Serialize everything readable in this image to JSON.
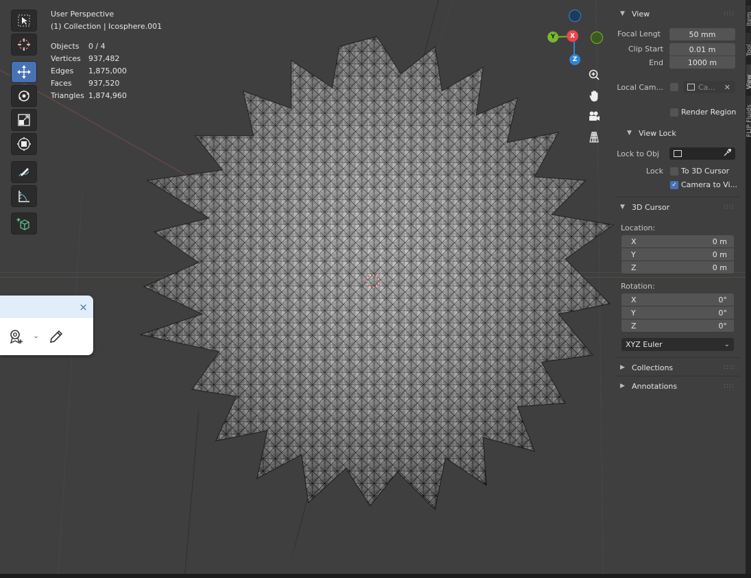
{
  "viewport": {
    "perspective": "User Perspective",
    "collection": "(1) Collection | Icosphere.001",
    "stats": [
      {
        "label": "Objects",
        "value": "0 / 4"
      },
      {
        "label": "Vertices",
        "value": "937,482"
      },
      {
        "label": "Edges",
        "value": "1,875,000"
      },
      {
        "label": "Faces",
        "value": "937,520"
      },
      {
        "label": "Triangles",
        "value": "1,874,960"
      }
    ]
  },
  "gizmo": {
    "x": "X",
    "y": "Y",
    "z": "Z",
    "colors": {
      "x": "#e5484d",
      "y": "#78b82a",
      "z": "#2f86d8"
    }
  },
  "toolbar": {
    "tools": [
      "select-box-icon",
      "cursor-icon",
      "move-icon",
      "rotate-icon",
      "scale-icon",
      "transform-icon",
      "annotate-icon",
      "measure-icon",
      "add-cube-icon"
    ],
    "active_tool": "move-icon"
  },
  "sidebar": {
    "view": {
      "title": "View",
      "focal_length_label": "Focal Lengt",
      "focal_length_value": "50 mm",
      "clip_start_label": "Clip Start",
      "clip_start_value": "0.01 m",
      "end_label": "End",
      "end_value": "1000 m",
      "local_camera_label": "Local Cam...",
      "local_camera_value": "Ca...",
      "render_region_label": "Render Region"
    },
    "view_lock": {
      "title": "View Lock",
      "lock_to_obj_label": "Lock to Obj",
      "lock_label": "Lock",
      "to_3d_cursor_label": "To 3D Cursor",
      "camera_to_view_label": "Camera to Vi..."
    },
    "cursor": {
      "title": "3D Cursor",
      "location_label": "Location:",
      "location": [
        {
          "axis": "X",
          "value": "0 m"
        },
        {
          "axis": "Y",
          "value": "0 m"
        },
        {
          "axis": "Z",
          "value": "0 m"
        }
      ],
      "rotation_label": "Rotation:",
      "rotation": [
        {
          "axis": "X",
          "value": "0°"
        },
        {
          "axis": "Y",
          "value": "0°"
        },
        {
          "axis": "Z",
          "value": "0°"
        }
      ],
      "rotation_mode": "XYZ Euler"
    },
    "collections_title": "Collections",
    "annotations_title": "Annotations"
  },
  "side_tabs": [
    "Item",
    "Tool",
    "View",
    "FLIP Fluids"
  ],
  "popup": {
    "close": "×"
  }
}
